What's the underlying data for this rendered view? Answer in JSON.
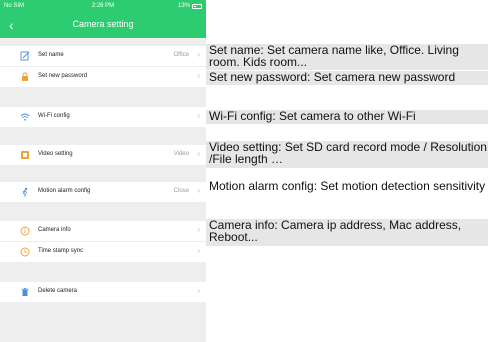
{
  "status_bar": {
    "carrier": "No SIM",
    "time": "2:26 PM",
    "battery": "13%"
  },
  "nav": {
    "title": "Camera setting",
    "back_icon": "chevron-left"
  },
  "rows": {
    "set_name": {
      "label": "Set name",
      "value": "Office",
      "icon": "edit-icon"
    },
    "set_password": {
      "label": "Set new password",
      "icon": "lock-icon"
    },
    "wifi_config": {
      "label": "Wi-Fi config",
      "icon": "wifi-icon"
    },
    "video_setting": {
      "label": "Video setting",
      "value": "Video",
      "icon": "video-icon"
    },
    "motion_alarm": {
      "label": "Motion alarm config",
      "value": "Close",
      "icon": "motion-icon"
    },
    "camera_info": {
      "label": "Camera info",
      "icon": "info-icon"
    },
    "time_sync": {
      "label": "Time stamp sync",
      "icon": "clock-icon"
    },
    "delete_camera": {
      "label": "Delete camera",
      "icon": "trash-icon"
    }
  },
  "annotations": {
    "set_name": "Set name:  Set camera name like, Office. Living room. Kids room...",
    "set_password": "Set new password: Set camera new password",
    "wifi_config": "Wi-Fi config:  Set camera to other Wi-Fi",
    "video_setting": "Video setting:  Set SD card record mode / Resolution /File length …",
    "motion_alarm": "Motion alarm config:  Set motion detection sensitivity",
    "camera_info": "Camera info: Camera ip address, Mac address, Reboot..."
  },
  "colors": {
    "accent": "#2ecc71",
    "orange_icon": "#f0a030",
    "blue_icon": "#4a90d9",
    "chevron": "#bbbbbb"
  }
}
